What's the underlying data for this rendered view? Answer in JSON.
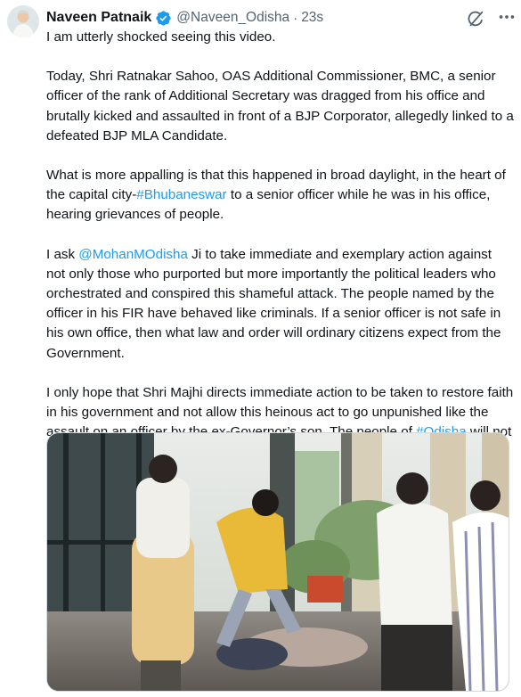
{
  "author": {
    "name": "Naveen Patnaik",
    "handle": "@Naveen_Odisha",
    "separator": "·",
    "time": "23s"
  },
  "tweet": {
    "p1": "I am utterly shocked seeing this video.",
    "p2": "Today, Shri Ratnakar Sahoo, OAS Additional Commissioner, BMC, a senior officer of the rank of Additional Secretary was dragged from his office and brutally kicked and assaulted in front of a BJP Corporator, allegedly linked to a defeated BJP MLA Candidate.",
    "p3_a": "What is more appalling is that this happened in broad daylight, in the heart of the capital city-",
    "p3_link": "#Bhubaneswar",
    "p3_b": " to a senior officer while he was in his office, hearing grievances of people.",
    "p4_a": "I ask ",
    "p4_link": "@MohanMOdisha",
    "p4_b": " Ji to take immediate and exemplary action against not only those who purported but more importantly the political leaders who orchestrated and conspired this shameful attack. The people named by the officer in his FIR have behaved like criminals. If a senior officer is not safe in his own office, then what law and order will ordinary citizens expect from the Government.",
    "p5_a": "I only hope that Shri Majhi directs immediate action to be taken to restore faith in his government and not allow this heinous act to go unpunished like the assault on an officer by the ex-Governor’s son. The people of ",
    "p5_link": "#Odisha",
    "p5_b": " will not forgive this."
  },
  "icons": {
    "verified": "verified-badge-icon",
    "grok": "grok-icon",
    "more": "more-options-icon"
  },
  "colors": {
    "link": "#1d9bf0",
    "verified": "#1d9bf0",
    "secondary_text": "#536471"
  }
}
